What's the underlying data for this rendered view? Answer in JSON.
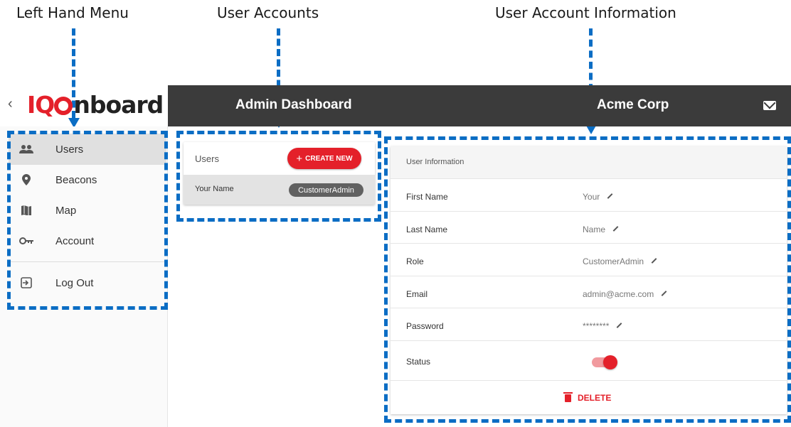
{
  "annotations": [
    {
      "label": "Left Hand Menu"
    },
    {
      "label": "User Accounts"
    },
    {
      "label": "User Account Information"
    }
  ],
  "logo": {
    "prefix": "IQ",
    "suffix": "nboard"
  },
  "topbar": {
    "title": "Admin Dashboard",
    "organization": "Acme Corp",
    "mail_icon": "mail-icon"
  },
  "sidebar": {
    "items": [
      {
        "label": "Users",
        "icon": "people-icon",
        "active": true
      },
      {
        "label": "Beacons",
        "icon": "location-pin-icon"
      },
      {
        "label": "Map",
        "icon": "map-icon"
      },
      {
        "label": "Account",
        "icon": "key-icon"
      },
      {
        "label": "Log Out",
        "icon": "exit-icon"
      }
    ]
  },
  "users_panel": {
    "header": "Users",
    "create_button": "CREATE NEW",
    "rows": [
      {
        "name": "Your Name",
        "role": "CustomerAdmin"
      }
    ]
  },
  "user_info": {
    "header": "User Information",
    "fields": [
      {
        "label": "First Name",
        "value": "Your"
      },
      {
        "label": "Last Name",
        "value": "Name"
      },
      {
        "label": "Role",
        "value": "CustomerAdmin"
      },
      {
        "label": "Email",
        "value": "admin@acme.com"
      },
      {
        "label": "Password",
        "value": "********"
      }
    ],
    "status_label": "Status",
    "status_on": true,
    "delete_label": "DELETE"
  },
  "colors": {
    "brand_red": "#e4202a",
    "topbar": "#3b3b3b",
    "annotation_blue": "#0b6dc4"
  }
}
